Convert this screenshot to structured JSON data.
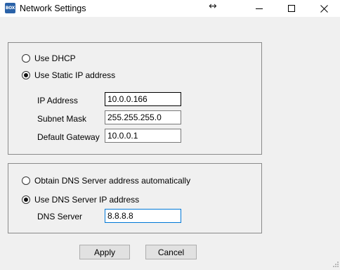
{
  "window": {
    "title": "Network Settings",
    "app_icon_text": "BOX",
    "resize_indicator": "↔",
    "controls": [
      "minimize",
      "maximize",
      "close"
    ]
  },
  "ip_group": {
    "dhcp_label": "Use DHCP",
    "static_label": "Use Static IP address",
    "selected": "static",
    "fields": {
      "ip_label": "IP Address",
      "ip_value": "10.0.0.166",
      "subnet_label": "Subnet Mask",
      "subnet_value": "255.255.255.0",
      "gateway_label": "Default Gateway",
      "gateway_value": "10.0.0.1"
    }
  },
  "dns_group": {
    "auto_label": "Obtain DNS Server address automatically",
    "manual_label": "Use DNS Server IP address",
    "selected": "manual",
    "server_label": "DNS Server",
    "server_value": "8.8.8.8"
  },
  "buttons": {
    "apply": "Apply",
    "cancel": "Cancel"
  },
  "icons": {
    "minimize": "minimize-icon",
    "maximize": "maximize-icon",
    "close": "close-icon"
  }
}
